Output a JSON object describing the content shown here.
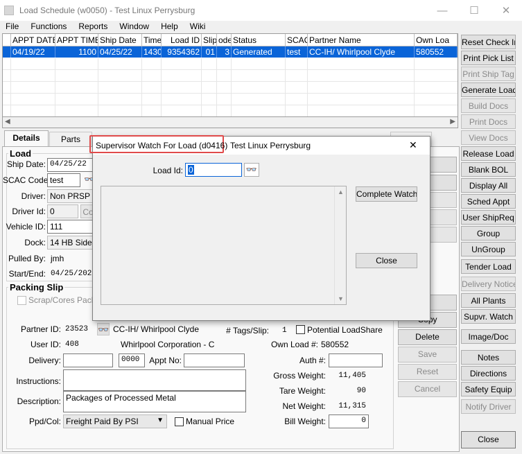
{
  "window": {
    "title": "Load Schedule (w0050) - Test Linux Perrysburg",
    "minimize": "—",
    "maximize": "☐",
    "close": "✕"
  },
  "menu": [
    "File",
    "Functions",
    "Reports",
    "Window",
    "Help",
    "Wiki"
  ],
  "grid": {
    "headers": [
      "APPT DATE",
      "APPT TIME",
      "Ship Date",
      "Time",
      "Load ID",
      "Slip",
      "ode",
      "Status",
      "SCAC",
      "Partner Name",
      "Own Loa"
    ],
    "row": [
      "04/19/22",
      "1100",
      "04/25/22",
      "1430",
      "9354362",
      "01",
      "3",
      "Generated",
      "test",
      "CC-IH/ Whirlpool Clyde",
      "580552"
    ]
  },
  "tabs": [
    "Details",
    "Parts"
  ],
  "load": {
    "group_label": "Load",
    "ship_date_label": "Ship Date:",
    "ship_date": "04/25/22",
    "scac_label": "SCAC Code:",
    "scac": "test",
    "driver_label": "Driver:",
    "driver": "Non PRSP D",
    "driver_id_label": "Driver Id:",
    "driver_id": "0",
    "driver_id_btn": "Co",
    "vehicle_label": "Vehicle ID:",
    "vehicle": "111",
    "dock_label": "Dock:",
    "dock": "14 HB Side L",
    "pulled_label": "Pulled By:",
    "pulled": "jmh",
    "startend_label": "Start/End:",
    "startend": "04/25/202"
  },
  "packing": {
    "group_label": "Packing Slip",
    "scrap_label": "Scrap/Cores Packin",
    "partner_id_label": "Partner ID:",
    "partner_id": "23523",
    "partner_name": "CC-IH/ Whirlpool Clyde",
    "tags_label": "# Tags/Slip:",
    "tags": "1",
    "potential_label": "Potential LoadShare",
    "user_id_label": "User ID:",
    "user_id": "408",
    "user_corp": "Whirlpool Corporation - C",
    "own_load_label": "Own Load #:",
    "own_load": "580552",
    "delivery_label": "Delivery:",
    "delivery": "",
    "delivery_time": "0000",
    "appt_no_label": "Appt No:",
    "appt_no": "",
    "auth_label": "Auth #:",
    "auth": "",
    "instructions_label": "Instructions:",
    "instructions": "",
    "gross_label": "Gross Weight:",
    "gross": "11,405",
    "tare_label": "Tare Weight:",
    "tare": "90",
    "description_label": "Description:",
    "description": "Packages of Processed Metal",
    "net_label": "Net Weight:",
    "net": "11,315",
    "ppd_label": "Ppd/Col:",
    "ppd": "Freight Paid By PSI",
    "manual_price_label": "Manual Price",
    "bill_label": "Bill Weight:",
    "bill": "0"
  },
  "mid_buttons": [
    "Copy",
    "Delete",
    "Save",
    "Reset",
    "Cancel"
  ],
  "right_buttons": [
    "Reset Check In",
    "Print Pick List",
    "Print Ship Tag",
    "Generate Load",
    "Build Docs",
    "Print Docs",
    "View Docs",
    "Release Load",
    "Blank BOL",
    "Display All",
    "Sched Appt",
    "User ShipReq",
    "Group",
    "UnGroup",
    "Tender Load",
    "Delivery Notice",
    "All Plants",
    "Supvr. Watch",
    "Image/Doc",
    "Notes",
    "Directions",
    "Safety Equip",
    "Notify Driver",
    "Close"
  ],
  "dialog": {
    "title_code": "Supervisor Watch For Load (d0416)",
    "title_rest": "Test Linux Perrysburg",
    "close": "✕",
    "load_id_label": "Load Id:",
    "load_id": "0",
    "complete_watch": "Complete Watch",
    "close_button": "Close"
  },
  "colors": {
    "selection": "#0a64d8",
    "highlight_box": "#e04a4a"
  }
}
